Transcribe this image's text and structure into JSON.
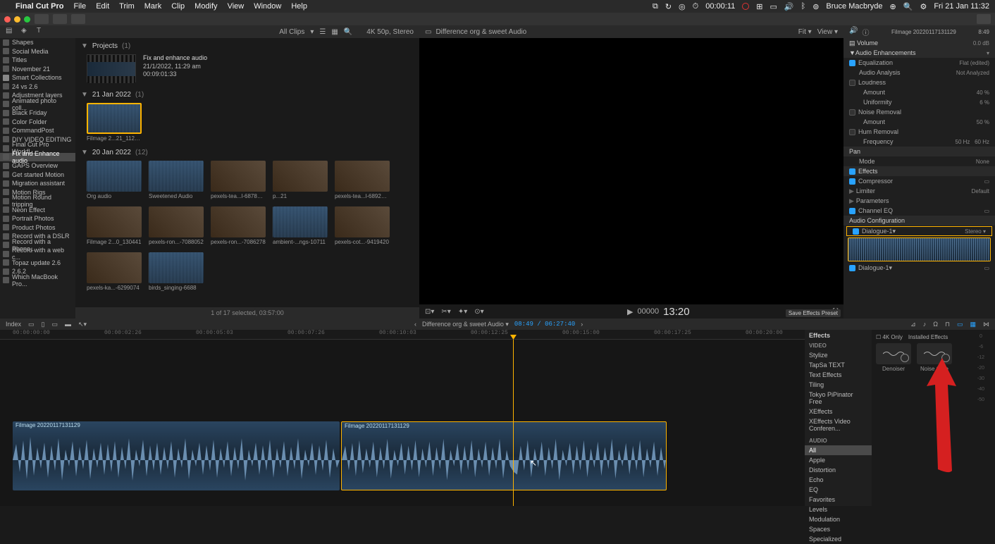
{
  "menubar": {
    "app": "Final Cut Pro",
    "items": [
      "File",
      "Edit",
      "Trim",
      "Mark",
      "Clip",
      "Modify",
      "View",
      "Window",
      "Help"
    ],
    "time": "00:00:11",
    "user": "Bruce Macbryde",
    "date": "Fri 21 Jan  11:32"
  },
  "header": {
    "clips_filter": "All Clips",
    "format": "4K 50p, Stereo",
    "viewer_title": "Difference org & sweet Audio",
    "fit": "Fit",
    "view": "View",
    "clip_name": "Filmage 20220117131129",
    "clip_tc": "8:49"
  },
  "sidebar": {
    "items": [
      {
        "label": "Shapes"
      },
      {
        "label": "Social Media"
      },
      {
        "label": "Titles"
      },
      {
        "label": "November 21"
      },
      {
        "label": "Smart Collections",
        "star": true
      },
      {
        "label": "24 vs 2.6"
      },
      {
        "label": "Adjustment layers"
      },
      {
        "label": "Animated photo coll..."
      },
      {
        "label": "Black Friday"
      },
      {
        "label": "Color Folder"
      },
      {
        "label": "CommandPost"
      },
      {
        "label": "DIY VIDEO EDITING"
      },
      {
        "label": "Final Cut Pro Workfl..."
      },
      {
        "label": "Fix and Enhance audio",
        "sel": true
      },
      {
        "label": "GAPS Overview"
      },
      {
        "label": "Get started Motion"
      },
      {
        "label": "Migration assistant"
      },
      {
        "label": "Motion Rigs"
      },
      {
        "label": "Motion Round tripping"
      },
      {
        "label": "Neon Effect"
      },
      {
        "label": "Portrait Photos"
      },
      {
        "label": "Product Photos"
      },
      {
        "label": "Record with a DSLR"
      },
      {
        "label": "Record with a Phone..."
      },
      {
        "label": "Record with a web c..."
      },
      {
        "label": "Topaz update 2.6"
      },
      {
        "label": "2.6.2"
      },
      {
        "label": "Which MacBook Pro..."
      }
    ]
  },
  "browser": {
    "projects": {
      "label": "Projects",
      "count": "(1)"
    },
    "project": {
      "name": "Fix and enhance audio",
      "date": "21/1/2022, 11:29 am",
      "dur": "00:09:01:33"
    },
    "events": [
      {
        "label": "21 Jan 2022",
        "count": "(1)",
        "clips": [
          {
            "name": "Filmage 2...21_112016",
            "wave": true,
            "sel": true
          }
        ]
      },
      {
        "label": "20 Jan 2022",
        "count": "(12)",
        "clips": [
          {
            "name": "Org audio",
            "wave": true
          },
          {
            "name": "Sweetened Audio",
            "wave": true
          },
          {
            "name": "pexels-tea...l-6878738",
            "img": true
          },
          {
            "name": "p...21",
            "img": true
          },
          {
            "name": "pexels-tea...l-6892918",
            "img": true
          },
          {
            "name": "Filmage 2...0_130441",
            "img": true
          },
          {
            "name": "pexels-ron...-7088052",
            "img": true
          },
          {
            "name": "pexels-ron...-7086278",
            "img": true
          },
          {
            "name": "ambient-...ngs-10711",
            "wave": true
          },
          {
            "name": "pexels-cot...-9419420",
            "img": true
          },
          {
            "name": "pexels-ka...-6299074",
            "img": true
          },
          {
            "name": "birds_singing-6688",
            "wave": true
          }
        ]
      }
    ],
    "footer": "1 of 17 selected, 03:57:00"
  },
  "viewer": {
    "tc_small": "00000",
    "tc_big": "13:20",
    "save_preset": "Save Effects Preset"
  },
  "inspector": {
    "volume": {
      "label": "Volume",
      "val": "0.0 dB"
    },
    "enh_head": "Audio Enhancements",
    "eq": {
      "label": "Equalization",
      "val": "Flat (edited)"
    },
    "analysis": {
      "label": "Audio Analysis",
      "val": "Not Analyzed"
    },
    "loudness": {
      "label": "Loudness"
    },
    "amount": {
      "label": "Amount",
      "val": "40 %"
    },
    "uniformity": {
      "label": "Uniformity",
      "val": "6 %"
    },
    "noise": {
      "label": "Noise Removal"
    },
    "amount2": {
      "label": "Amount",
      "val": "50 %"
    },
    "hum": {
      "label": "Hum Removal"
    },
    "freq": {
      "label": "Frequency",
      "v1": "50 Hz",
      "v2": "60 Hz"
    },
    "pan": {
      "label": "Pan"
    },
    "mode": {
      "label": "Mode",
      "val": "None"
    },
    "effects": {
      "label": "Effects"
    },
    "comp": {
      "label": "Compressor"
    },
    "limiter": {
      "label": "Limiter",
      "val": "Default"
    },
    "params": {
      "label": "Parameters"
    },
    "cheq": {
      "label": "Channel EQ"
    },
    "audioconf": "Audio Configuration",
    "dialogue": {
      "label": "Dialogue-1",
      "val": "Stereo"
    }
  },
  "timeline": {
    "index": "Index",
    "title": "Difference org & sweet Audio",
    "tc": "08:49 / 06:27:40",
    "ruler": [
      "00:00:00:00",
      "00:00:02:26",
      "00:00:05:03",
      "00:00:07:26",
      "00:00:10:03",
      "00:00:12:25",
      "00:00:15:00",
      "00:00:17:25",
      "00:00:20:00"
    ],
    "clip1": "Filmage 20220117131129",
    "clip2": "Filmage 20220117131129"
  },
  "effects": {
    "head": "Effects",
    "k4": "4K Only",
    "installed": "Installed Effects",
    "video_head": "VIDEO",
    "video": [
      "Stylize",
      "TapSa TEXT",
      "Text Effects",
      "Tiling",
      "Tokyo PiPinator Free",
      "XEffects",
      "XEffects Video Conferen..."
    ],
    "audio_head": "AUDIO",
    "audio": [
      {
        "l": "All",
        "sel": true
      },
      {
        "l": "Apple"
      },
      {
        "l": "Distortion"
      },
      {
        "l": "Echo"
      },
      {
        "l": "EQ"
      },
      {
        "l": "Favorites"
      },
      {
        "l": "Levels"
      },
      {
        "l": "Modulation"
      },
      {
        "l": "Spaces"
      },
      {
        "l": "Specialized"
      }
    ],
    "thumbs": [
      {
        "l": "Denoiser"
      },
      {
        "l": "Noise Gate"
      }
    ]
  }
}
